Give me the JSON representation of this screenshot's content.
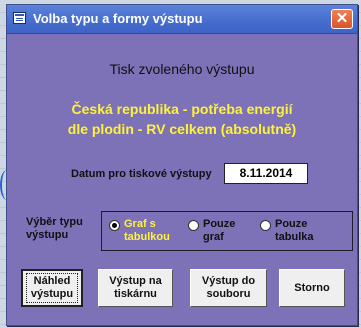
{
  "window": {
    "title": "Volba typu a formy výstupu",
    "close_glyph": "✕"
  },
  "heading": "Tisk zvoleného výstupu",
  "subtitle": {
    "line1": "Česká republika - potřeba energií",
    "line2": "dle plodin - RV celkem (absolutně)"
  },
  "date": {
    "label": "Datum pro tiskové výstupy",
    "value": "8.11.2014"
  },
  "output_type": {
    "label_line1": "Výběr typu",
    "label_line2": "výstupu",
    "options": [
      {
        "line1": "Graf s",
        "line2": "tabulkou",
        "selected": true
      },
      {
        "line1": "Pouze",
        "line2": "graf",
        "selected": false
      },
      {
        "line1": "Pouze",
        "line2": "tabulka",
        "selected": false
      }
    ]
  },
  "buttons": {
    "preview": {
      "line1": "Náhled",
      "line2": "výstupu"
    },
    "print": {
      "line1": "Výstup na",
      "line2": "tiskárnu"
    },
    "file": {
      "line1": "Výstup do",
      "line2": "souboru"
    },
    "cancel": {
      "line1": "Storno"
    }
  },
  "colors": {
    "dialog_bg": "#7d71b8",
    "titlebar": "#4a72d0",
    "highlight_text": "#fff33a"
  }
}
